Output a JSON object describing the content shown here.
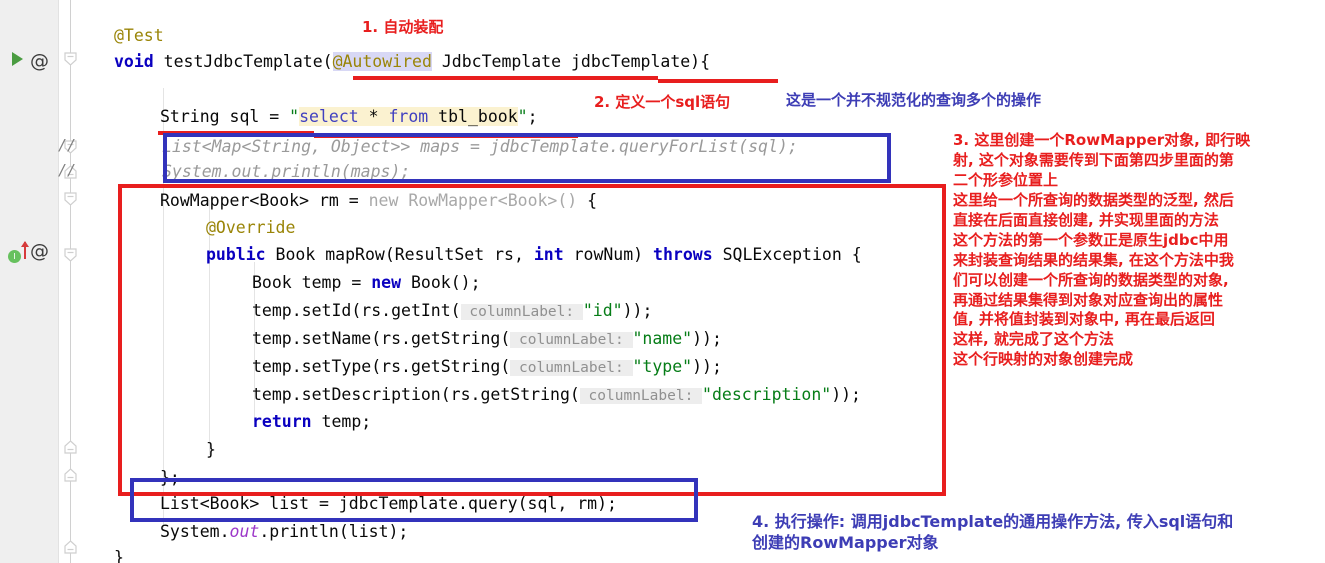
{
  "editor": {
    "gutter": {
      "run_icon": "run-triangle-icon",
      "annotation_marker_1": "at-symbol-icon",
      "annotation_marker_2": "at-symbol-icon",
      "implementation_badge": "I",
      "override_arrow": "override-arrow-icon",
      "comment_marker_1": "//",
      "comment_marker_2": "//"
    },
    "code_lines": [
      {
        "id": "l-test-anno",
        "text": "@Test"
      },
      {
        "id": "l-method-sig",
        "text": "void testJdbcTemplate(@Autowired JdbcTemplate jdbcTemplate){"
      },
      {
        "id": "l-sql",
        "text": "String sql = \"select * from tbl_book\";"
      },
      {
        "id": "l-cmt-1",
        "text": "List<Map<String, Object>> maps = jdbcTemplate.queryForList(sql);"
      },
      {
        "id": "l-cmt-2",
        "text": "System.out.println(maps);"
      },
      {
        "id": "l-rowmapper",
        "text": "RowMapper<Book> rm = new RowMapper<Book>() {"
      },
      {
        "id": "l-override",
        "text": "@Override"
      },
      {
        "id": "l-maprow",
        "text": "public Book mapRow(ResultSet rs, int rowNum) throws SQLException {"
      },
      {
        "id": "l-booktemp",
        "text": "Book temp = new Book();"
      },
      {
        "id": "l-setid",
        "text": "temp.setId(rs.getInt( columnLabel: \"id\"));"
      },
      {
        "id": "l-setname",
        "text": "temp.setName(rs.getString( columnLabel: \"name\"));"
      },
      {
        "id": "l-settype",
        "text": "temp.setType(rs.getString( columnLabel: \"type\"));"
      },
      {
        "id": "l-setdesc",
        "text": "temp.setDescription(rs.getString( columnLabel: \"description\"));"
      },
      {
        "id": "l-return",
        "text": "return temp;"
      },
      {
        "id": "l-close-brace",
        "text": "}"
      },
      {
        "id": "l-close-anon",
        "text": "};"
      },
      {
        "id": "l-query",
        "text": "List<Book> list = jdbcTemplate.query(sql, rm);"
      },
      {
        "id": "l-println",
        "text": "System.out.println(list);"
      },
      {
        "id": "l-method-end",
        "text": "}"
      }
    ],
    "tokens": {
      "kw_void": "void",
      "method_name": "testJdbcTemplate",
      "anno_test": "@Test",
      "anno_autowired": "@Autowired",
      "anno_override": "@Override",
      "type_jdbctemplate": "JdbcTemplate",
      "var_jdbctemplate": "jdbcTemplate",
      "type_string": "String",
      "var_sql": "sql",
      "sql_literal": "select * from tbl_book",
      "param_hint": "columnLabel:",
      "str_id": "\"id\"",
      "str_name": "\"name\"",
      "str_type": "\"type\"",
      "str_description": "\"description\"",
      "kw_new": "new",
      "kw_public": "public",
      "kw_int": "int",
      "kw_throws": "throws",
      "kw_return": "return",
      "static_out": "out"
    }
  },
  "annotations": [
    {
      "id": "note-1",
      "color": "#e81e1e",
      "lines": [
        "1. 自动装配"
      ]
    },
    {
      "id": "note-2",
      "color": "#e81e1e",
      "lines": [
        "2. 定义一个sql语句"
      ]
    },
    {
      "id": "note-3",
      "color": "#3d3db5",
      "lines": [
        "这是一个并不规范化的查询多个的操作"
      ]
    },
    {
      "id": "note-4",
      "color": "#e81e1e",
      "lines": [
        "3. 这里创建一个RowMapper对象, 即行映",
        "射, 这个对象需要传到下面第四步里面的第",
        "二个形参位置上",
        "这里给一个所查询的数据类型的泛型, 然后",
        "直接在后面直接创建, 并实现里面的方法",
        "这个方法的第一个参数正是原生jdbc中用",
        "来封装查询结果的结果集, 在这个方法中我",
        "们可以创建一个所查询的数据类型的对象,",
        "再通过结果集得到对象对应查询出的属性",
        "值, 并将值封装到对象中, 再在最后返回",
        "这样, 就完成了这个方法",
        "这个行映射的对象创建完成"
      ]
    },
    {
      "id": "note-5",
      "color": "#3d3db5",
      "lines": [
        "4. 执行操作: 调用jdbcTemplate的通用操作方法, 传入sql语句和",
        "创建的RowMapper对象"
      ]
    }
  ],
  "colors": {
    "annotation_red": "#e81e1e",
    "annotation_blue": "#3333bb",
    "keyword_blue": "#0a00c0",
    "string_green": "#067d17",
    "annotation_olive": "#9a8508",
    "comment_grey": "#9a9a9a",
    "gutter_bg": "#efefef",
    "sql_highlight": "#fbf2d0",
    "autowired_highlight": "#d8d8f5"
  }
}
